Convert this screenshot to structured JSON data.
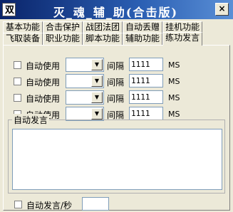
{
  "window": {
    "icon_text": "双",
    "title": "灭_魂_辅_助(合击版)",
    "close_label": "×"
  },
  "tabs": {
    "row1": [
      "基本功能",
      "合击保护",
      "战团法团",
      "自动丢赠",
      "挂机功能"
    ],
    "row2": [
      "飞取装备",
      "职业功能",
      "脚本功能",
      "辅助功能",
      "练功发言"
    ],
    "active": "练功发言"
  },
  "rows": [
    {
      "label": "自动使用",
      "interval_label": "间隔",
      "interval_value": "1111",
      "unit": "MS",
      "checked": false
    },
    {
      "label": "自动使用",
      "interval_label": "间隔",
      "interval_value": "1111",
      "unit": "MS",
      "checked": false
    },
    {
      "label": "自动使用",
      "interval_label": "间隔",
      "interval_value": "1111",
      "unit": "MS",
      "checked": false
    },
    {
      "label": "自动使用",
      "interval_label": "间隔",
      "interval_value": "1111",
      "unit": "MS",
      "checked": false
    }
  ],
  "speech_group": {
    "title": "自动发言",
    "text": ""
  },
  "bottom": {
    "label": "自动发言/秒",
    "value": ""
  },
  "colors": {
    "titlebar": "#0a246a",
    "face": "#ece9d8"
  }
}
